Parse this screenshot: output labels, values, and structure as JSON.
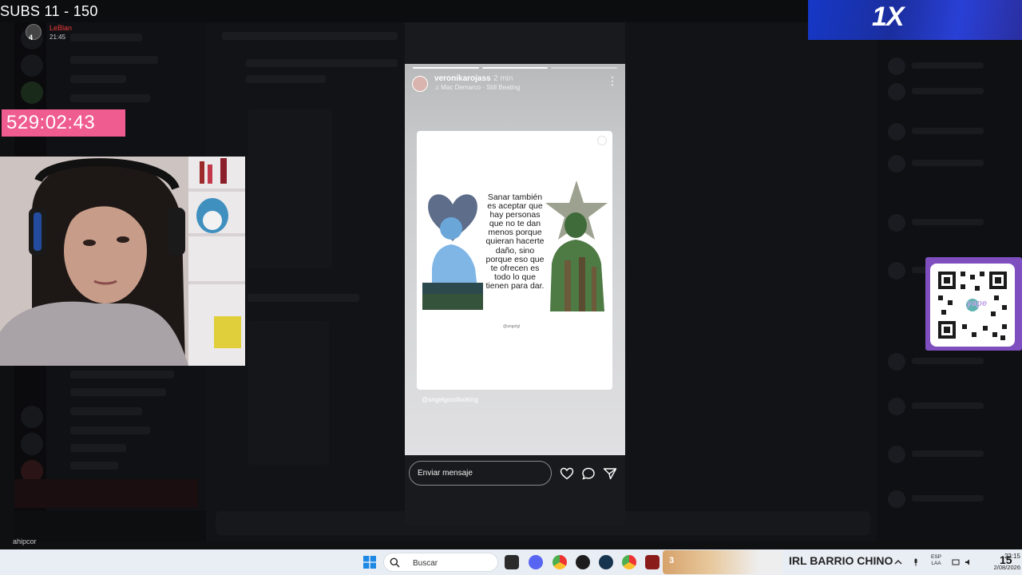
{
  "overlay": {
    "subs_goal": "SUBS 11 - 150",
    "timer": "529:02:43",
    "stream_badge": {
      "user": "LeBlan",
      "count": "4",
      "time": "21:45"
    },
    "brand_logo": "1X",
    "qr_label": "yape",
    "bottom_text": "ahipcor",
    "banner": "IRL BARRIO CHINO",
    "alert_number": "15"
  },
  "story": {
    "username": "veronikarojass",
    "age": "2 min",
    "song": "Mac Demarco · Still Beating",
    "quote": "Sanar también es aceptar que hay personas que no te dan menos porque quieran hacerte daño, sino porque eso que te ofrecen es todo lo que tienen para dar.",
    "quote_credit": "@angelgl",
    "mention": "@angelgoodlooking",
    "reply_placeholder": "Enviar mensaje",
    "progress_segments": 3,
    "progress_done": 2,
    "icons": [
      "heart-icon",
      "comment-icon",
      "send-icon"
    ]
  },
  "taskbar": {
    "search_placeholder": "Buscar",
    "widget_number": "3",
    "language": "ESP",
    "language_sub": "LAA",
    "time": "22:15",
    "date": "2/08/2026",
    "apps": [
      "windows-logo",
      "file-explorer",
      "discord",
      "chrome",
      "obs",
      "steam",
      "chrome",
      "app"
    ]
  },
  "colors": {
    "timer_bg": "#ef5c8f",
    "brand_bg": "#1638c7",
    "qr_frame": "#7f4fbf",
    "taskbar_bg": "#e9eef4"
  }
}
